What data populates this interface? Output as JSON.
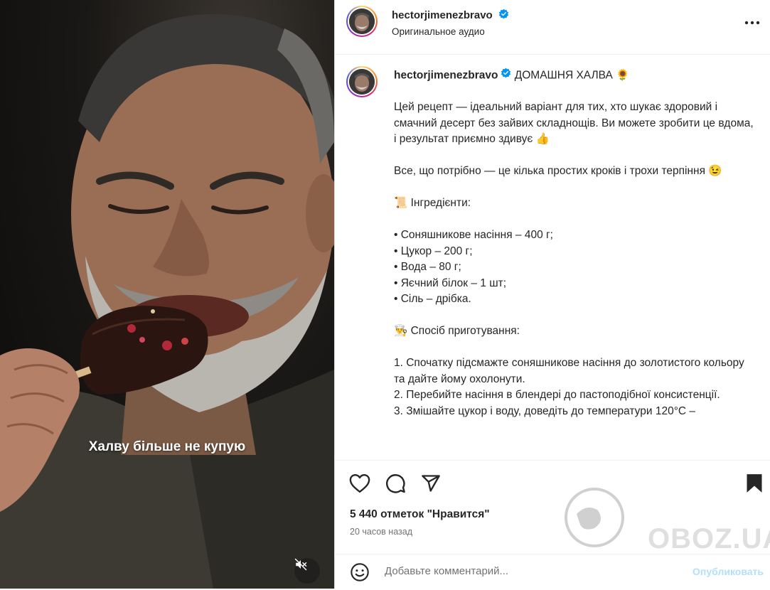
{
  "post": {
    "username": "hectorjimenezbravo",
    "audio": "Оригинальное аудио",
    "video_caption": "Халву більше не купую",
    "caption_title": "ДОМАШНЯ ХАЛВА 🌻",
    "caption_body": "Цей рецепт — ідеальний варіант для тих, хто шукає здоровий і смачний десерт без зайвих складнощів. Ви можете зробити це вдома, і результат приємно здивує 👍\n\nВсе, що потрібно — це кілька простих кроків і трохи терпіння 😉\n\n📜 Інгредієнти:\n\n• Соняшникове насіння – 400 г;\n• Цукор – 200 г;\n• Вода – 80 г;\n• Яєчний білок – 1 шт;\n• Сіль – дрібка.\n\n👨‍🍳 Спосіб приготування:\n\n1. Спочатку підсмажте соняшникове насіння до золотистого кольору та дайте йому охолонути.\n2. Перебийте насіння в блендері до пастоподібної консистенції.\n3. Змішайте цукор і воду, доведіть до температури 120°С –",
    "likes": "5 440 отметок \"Нравится\"",
    "time_ago": "20 часов назад"
  },
  "comment": {
    "placeholder": "Добавьте комментарий...",
    "publish_label": "Опубликовать"
  },
  "watermark": "OBOZ.UA",
  "icons": {
    "verified": "verified-badge-icon",
    "more": "more-options-icon",
    "like": "heart-icon",
    "comment": "comment-icon",
    "share": "share-icon",
    "save": "bookmark-icon",
    "emoji": "emoji-icon",
    "mute": "muted-speaker-icon"
  },
  "colors": {
    "verified_blue": "#0095f6",
    "publish_disabled": "#b2dffc",
    "secondary_text": "#737373"
  }
}
